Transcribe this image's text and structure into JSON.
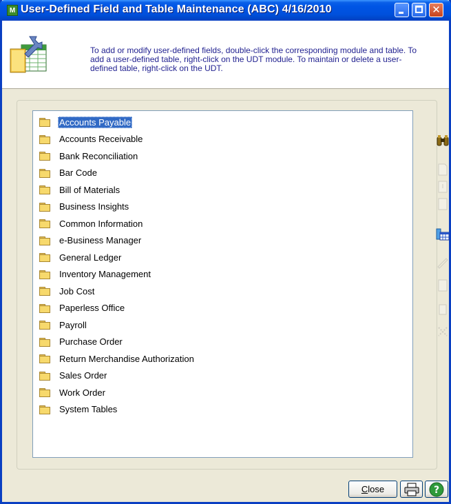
{
  "window": {
    "title": "User-Defined Field and Table Maintenance (ABC) 4/16/2010",
    "app_icon_text": "M"
  },
  "header": {
    "instructions": "To add or modify user-defined fields, double-click the corresponding module and table.  To add a user-defined table, right-click on the UDT module.  To maintain or delete a user-defined table, right-click on the UDT."
  },
  "tree": {
    "items": [
      {
        "label": "Accounts Payable",
        "selected": true
      },
      {
        "label": "Accounts Receivable"
      },
      {
        "label": "Bank Reconciliation"
      },
      {
        "label": "Bar Code"
      },
      {
        "label": "Bill of Materials"
      },
      {
        "label": "Business Insights"
      },
      {
        "label": "Common Information"
      },
      {
        "label": "e-Business Manager"
      },
      {
        "label": "General Ledger"
      },
      {
        "label": "Inventory Management"
      },
      {
        "label": "Job Cost"
      },
      {
        "label": "Paperless Office"
      },
      {
        "label": "Payroll"
      },
      {
        "label": "Purchase Order"
      },
      {
        "label": "Return Merchandise Authorization"
      },
      {
        "label": "Sales Order"
      },
      {
        "label": "Work Order"
      },
      {
        "label": "System Tables"
      }
    ]
  },
  "toolbar": {
    "icons": [
      "binoculars-icon",
      "new-icon",
      "add-icon",
      "remove-icon",
      "table-icon",
      "edit-icon",
      "blank-icon",
      "blank2-icon",
      "disabled-icon"
    ]
  },
  "footer": {
    "close_label": "Close",
    "close_mnemonic": "C"
  },
  "colors": {
    "title_bar": "#0050DC",
    "selection": "#316AC5",
    "header_text": "#1F1F8F"
  }
}
